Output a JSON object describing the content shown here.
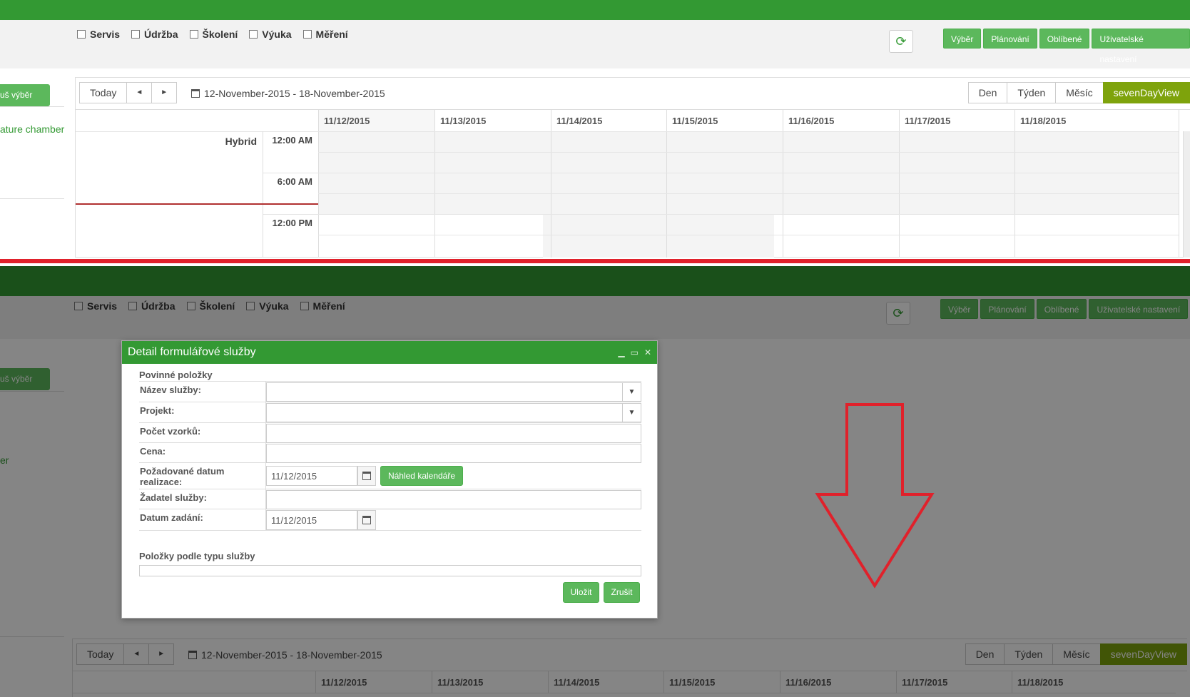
{
  "filters": [
    "Servis",
    "Údržba",
    "Školení",
    "Výuka",
    "Měření"
  ],
  "refresh_icon": "refresh-icon",
  "menu": [
    "Výběr",
    "Plánování",
    "Oblíbené",
    "Uživatelské nastavení"
  ],
  "sidebar": {
    "cancel_label": "uš výběr",
    "item_label": "ature chamber",
    "item_label_cut": "er"
  },
  "calendar": {
    "today_label": "Today",
    "prev_label": "◄",
    "next_label": "►",
    "range": "12-November-2015 - 18-November-2015",
    "views": [
      "Den",
      "Týden",
      "Měsíc",
      "sevenDayView"
    ],
    "active_view": "sevenDayView",
    "days": [
      "11/12/2015",
      "11/13/2015",
      "11/14/2015",
      "11/15/2015",
      "11/16/2015",
      "11/17/2015",
      "11/18/2015"
    ],
    "resource": "Hybrid",
    "times": [
      "12:00 AM",
      "6:00 AM",
      "12:00 PM"
    ]
  },
  "modal": {
    "title": "Detail formulářové služby",
    "required_section": "Povinné položky",
    "fields": {
      "service_name": "Název služby:",
      "project": "Projekt:",
      "sample_count": "Počet vzorků:",
      "price": "Cena:",
      "requested_date": "Požadované datum realizace:",
      "requester": "Žadatel služby:",
      "entry_date": "Datum zadání:"
    },
    "requested_date_value": "11/12/2015",
    "entry_date_value": "11/12/2015",
    "calendar_preview_label": "Náhled kalendáře",
    "type_section": "Položky podle typu služby",
    "save_label": "Uložit",
    "cancel_label": "Zrušit"
  },
  "colors": {
    "brand_green": "#339933",
    "button_green": "#5cb85c",
    "active_view": "#7ea30c",
    "annotation_red": "#e0212b"
  }
}
